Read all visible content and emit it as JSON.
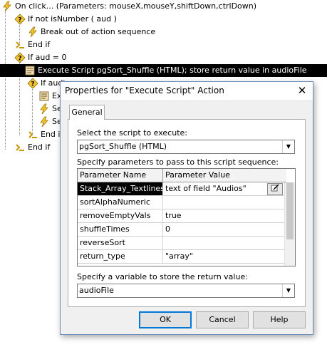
{
  "tree": {
    "rows": [
      {
        "text": "On click... (Parameters: mouseX,mouseY,shiftDown,ctrlDown)",
        "icon": "lightning-icon"
      },
      {
        "text": "If not isNumber ( aud )",
        "icon": "diamond-question-icon"
      },
      {
        "text": "Break out of action sequence",
        "icon": "lightning-icon"
      },
      {
        "text": "End if",
        "icon": "end-if-icon"
      },
      {
        "text": "If aud = 0",
        "icon": "diamond-question-icon"
      },
      {
        "text": "Execute Script pgSort_Shuffle (HTML); store return value in audioFile",
        "icon": "script-scroll-icon"
      },
      {
        "text": "If audio",
        "icon": "diamond-question-icon"
      },
      {
        "text": "Exe",
        "icon": "script-scroll-icon"
      },
      {
        "text": "Set",
        "icon": "lightning-icon"
      },
      {
        "text": "Set",
        "icon": "lightning-icon"
      },
      {
        "text": "End if",
        "icon": "end-if-icon"
      },
      {
        "text": "End if",
        "icon": "end-if-icon"
      }
    ]
  },
  "dialog": {
    "title": "Properties for \"Execute Script\" Action",
    "close_glyph": "✕",
    "tab_general": "General",
    "script_label": "Select the script to execute:",
    "script_value": "pgSort_Shuffle (HTML)",
    "params_label": "Specify parameters to pass to this script sequence:",
    "col_name": "Parameter Name",
    "col_value": "Parameter Value",
    "params": [
      {
        "name": "Stack_Array_Textlines",
        "value": "text of field \"Audios\""
      },
      {
        "name": "sortAlphaNumeric",
        "value": ""
      },
      {
        "name": "removeEmptyVals",
        "value": "true"
      },
      {
        "name": "shuffleTimes",
        "value": "0"
      },
      {
        "name": "reverseSort",
        "value": ""
      },
      {
        "name": "return_type",
        "value": "\"array\""
      }
    ],
    "variable_label": "Specify a variable to store the return value:",
    "variable_value": "audioFile",
    "ok": "OK",
    "cancel": "Cancel",
    "help": "Help"
  }
}
